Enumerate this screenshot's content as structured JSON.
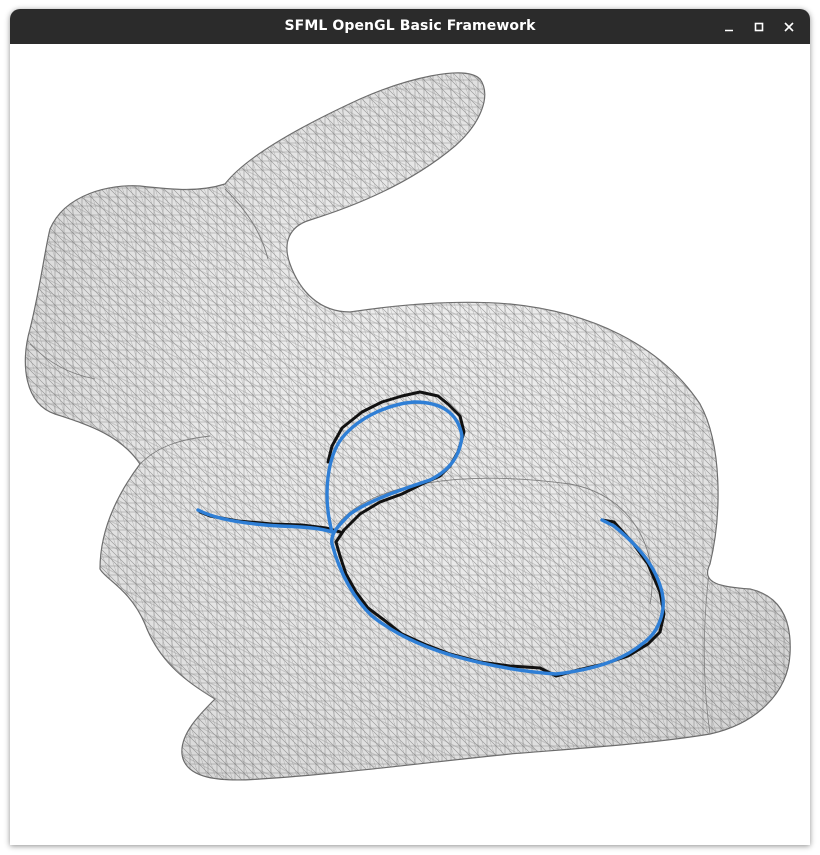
{
  "window": {
    "title": "SFML OpenGL Basic Framework",
    "controls": [
      {
        "name": "minimize",
        "icon": "minimize-icon"
      },
      {
        "name": "maximize",
        "icon": "maximize-icon"
      },
      {
        "name": "close",
        "icon": "close-icon"
      }
    ]
  },
  "viewport": {
    "background": "#ffffff",
    "mesh": {
      "subject": "bunny",
      "render_mode": "wireframe",
      "wire_color": "#8c8c8c",
      "fill_color": "#ececec"
    },
    "paths": [
      {
        "name": "geodesic-path-exact",
        "color": "#111111"
      },
      {
        "name": "geodesic-path-smooth",
        "color": "#2f7fd6"
      }
    ]
  }
}
